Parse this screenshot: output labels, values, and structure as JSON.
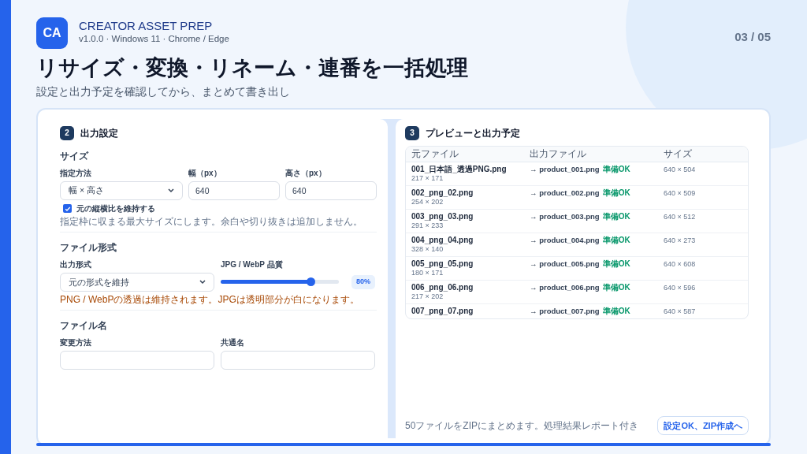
{
  "logo": "CA",
  "app_name": "CREATOR ASSET PREP",
  "version_line": "v1.0.0 · Windows 11 · Chrome / Edge",
  "page": "03 / 05",
  "title": "リサイズ・変換・リネーム・連番を一括処理",
  "subtitle": "設定と出力予定を確認してから、まとめて書き出し",
  "settings": {
    "step": "2",
    "heading": "出力設定",
    "size": {
      "label": "サイズ",
      "method_label": "指定方法",
      "method_value": "幅 × 高さ",
      "width_label": "幅（px）",
      "width_value": "640",
      "height_label": "高さ（px）",
      "height_value": "640",
      "keep_ratio": {
        "label": "元の縦横比を維持する",
        "checked": true
      },
      "hint": "指定枠に収まる最大サイズにします。余白や切り抜きは追加しません。"
    },
    "format": {
      "label": "ファイル形式",
      "output_label": "出力形式",
      "output_value": "元の形式を維持",
      "quality_label": "JPG / WebP 品質",
      "quality": {
        "level": 0.76,
        "reading": "80%"
      },
      "note": "PNG / WebPの透過は維持されます。JPGは透明部分が白になります。"
    },
    "filename": {
      "label": "ファイル名",
      "method_label": "変更方法",
      "common_label": "共通名"
    }
  },
  "preview": {
    "step": "3",
    "heading": "プレビューと出力予定",
    "columns": [
      "元ファイル",
      "出力ファイル",
      "サイズ"
    ],
    "rows": [
      {
        "source": "001_日本語_透過PNG.png",
        "source_size": "217 × 171",
        "output": "→ product_001.png",
        "status": "準備OK",
        "size": "640 × 504"
      },
      {
        "source": "002_png_02.png",
        "source_size": "254 × 202",
        "output": "→ product_002.png",
        "status": "準備OK",
        "size": "640 × 509"
      },
      {
        "source": "003_png_03.png",
        "source_size": "291 × 233",
        "output": "→ product_003.png",
        "status": "準備OK",
        "size": "640 × 512"
      },
      {
        "source": "004_png_04.png",
        "source_size": "328 × 140",
        "output": "→ product_004.png",
        "status": "準備OK",
        "size": "640 × 273"
      },
      {
        "source": "005_png_05.png",
        "source_size": "180 × 171",
        "output": "→ product_005.png",
        "status": "準備OK",
        "size": "640 × 608"
      },
      {
        "source": "006_png_06.png",
        "source_size": "217 × 202",
        "output": "→ product_006.png",
        "status": "準備OK",
        "size": "640 × 596"
      },
      {
        "source": "007_png_07.png",
        "output": "→ product_007.png",
        "status": "準備OK",
        "size": "640 × 587"
      }
    ],
    "footer_note": "50ファイルをZIPにまとめます。処理結果レポート付き",
    "button": "設定OK、ZIP作成へ"
  }
}
